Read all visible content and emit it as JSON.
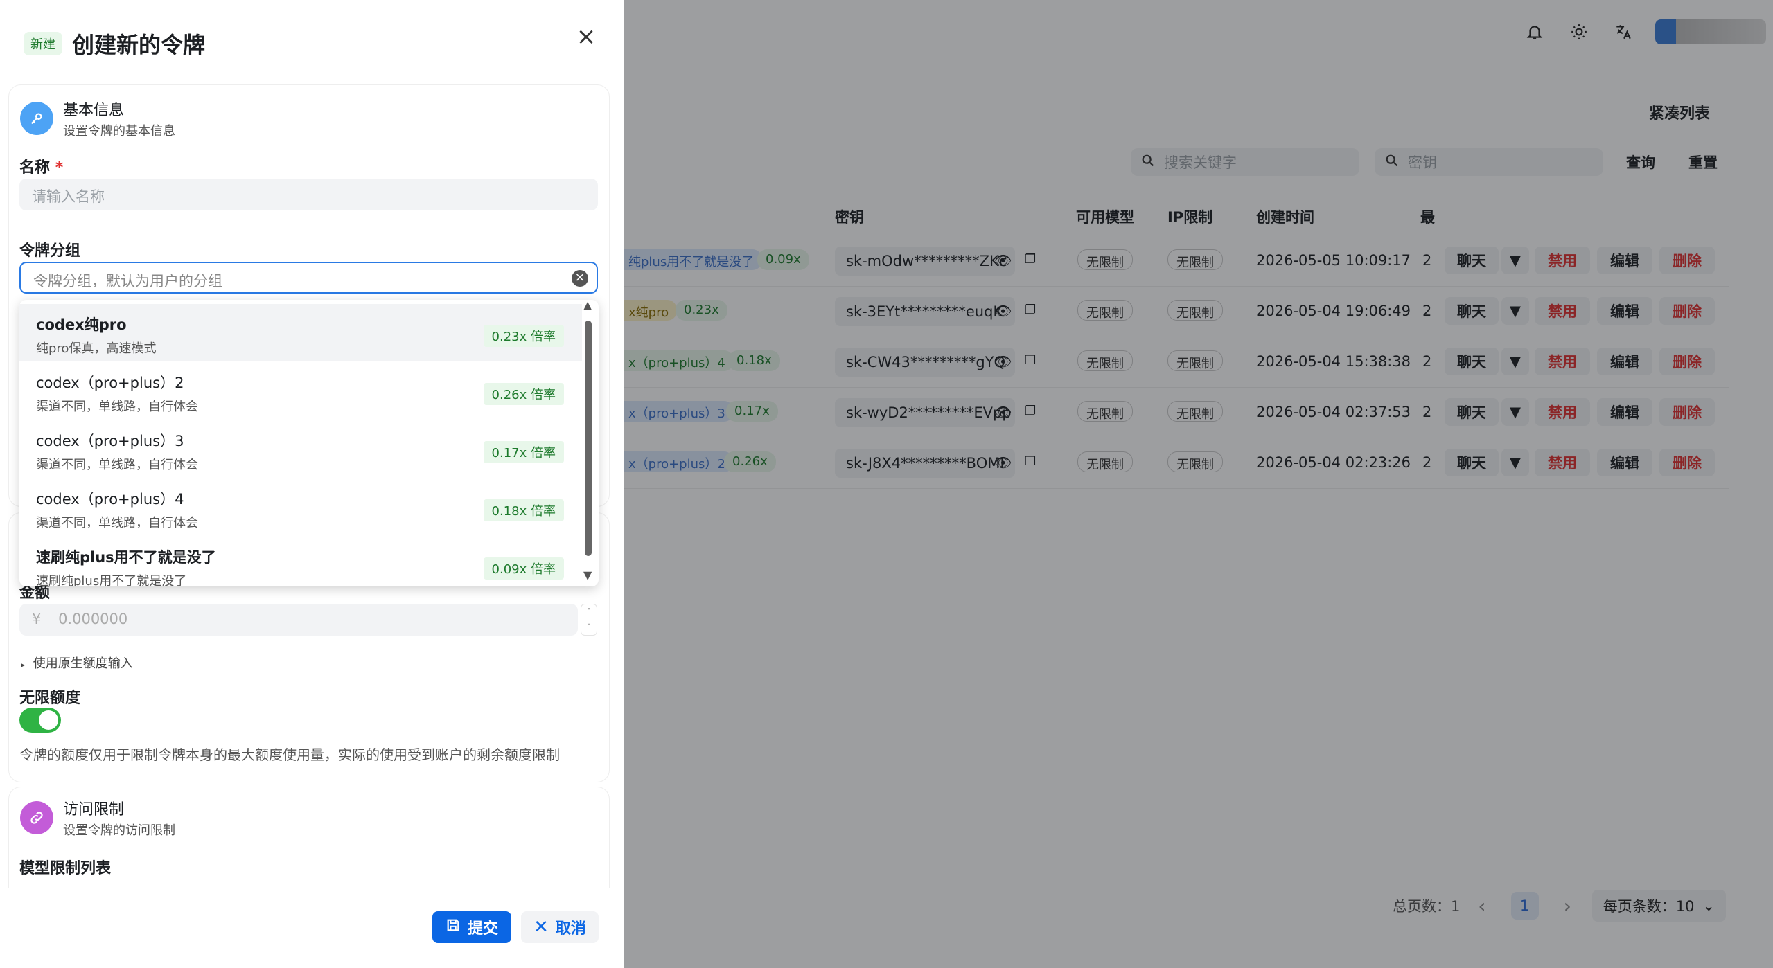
{
  "background": {
    "compact_list_label": "紧凑列表",
    "search_placeholder": "搜索关键字",
    "key_placeholder": "密钥",
    "query_label": "查询",
    "reset_label": "重置",
    "headers": {
      "key": "密钥",
      "models": "可用模型",
      "ip": "IP限制",
      "created": "创建时间",
      "extra": "最"
    },
    "rows": [
      {
        "group": "纯plus用不了就是没了",
        "rate": "0.09x",
        "key": "sk-mOdw*********ZKc",
        "models": "无限制",
        "ip": "无限制",
        "created": "2026-05-05 10:09:17",
        "extra": "2"
      },
      {
        "group": "x纯pro",
        "rate": "0.23x",
        "key": "sk-3EYt*********euqK",
        "models": "无限制",
        "ip": "无限制",
        "created": "2026-05-04 19:06:49",
        "extra": "2"
      },
      {
        "group": "x（pro+plus）4",
        "rate": "0.18x",
        "key": "sk-CW43*********gYQ",
        "models": "无限制",
        "ip": "无限制",
        "created": "2026-05-04 15:38:38",
        "extra": "2"
      },
      {
        "group": "x（pro+plus）3",
        "rate": "0.17x",
        "key": "sk-wyD2*********EVpp",
        "models": "无限制",
        "ip": "无限制",
        "created": "2026-05-04 02:37:53",
        "extra": "2"
      },
      {
        "group": "x（pro+plus）2",
        "rate": "0.26x",
        "key": "sk-J8X4*********BOMI",
        "models": "无限制",
        "ip": "无限制",
        "created": "2026-05-04 02:23:26",
        "extra": "2"
      }
    ],
    "actions": {
      "chat": "聊天",
      "disable": "禁用",
      "edit": "编辑",
      "delete": "删除"
    },
    "pager": {
      "total_label": "总页数：1",
      "current_page": "1",
      "page_size_label": "每页条数：10"
    }
  },
  "drawer": {
    "badge": "新建",
    "title": "创建新的令牌",
    "basic": {
      "title": "基本信息",
      "subtitle": "设置令牌的基本信息"
    },
    "name_label": "名称",
    "required_mark": "*",
    "name_placeholder": "请输入名称",
    "group_label": "令牌分组",
    "group_placeholder": "令牌分组，默认为用户的分组",
    "options": [
      {
        "name": "codex纯pro",
        "desc": "纯pro保真，高速模式",
        "rate": "0.23x 倍率"
      },
      {
        "name": "codex（pro+plus）2",
        "desc": "渠道不同，单线路，自行体会",
        "rate": "0.26x 倍率"
      },
      {
        "name": "codex（pro+plus）3",
        "desc": "渠道不同，单线路，自行体会",
        "rate": "0.17x 倍率"
      },
      {
        "name": "codex（pro+plus）4",
        "desc": "渠道不同，单线路，自行体会",
        "rate": "0.18x 倍率"
      },
      {
        "name": "速刷纯plus用不了就是没了",
        "desc": "速刷纯plus用不了就是没了",
        "rate": "0.09x 倍率"
      }
    ],
    "amount_label": "金额",
    "currency": "¥",
    "amount_placeholder": "0.000000",
    "native_toggle": "使用原生额度输入",
    "unlimited_label": "无限额度",
    "unlimited_on": true,
    "quota_note": "令牌的额度仅用于限制令牌本身的最大额度使用量，实际的使用受到账户的剩余额度限制",
    "access": {
      "title": "访问限制",
      "subtitle": "设置令牌的访问限制"
    },
    "model_limit_label": "模型限制列表",
    "submit_label": "提交",
    "cancel_label": "取消"
  }
}
